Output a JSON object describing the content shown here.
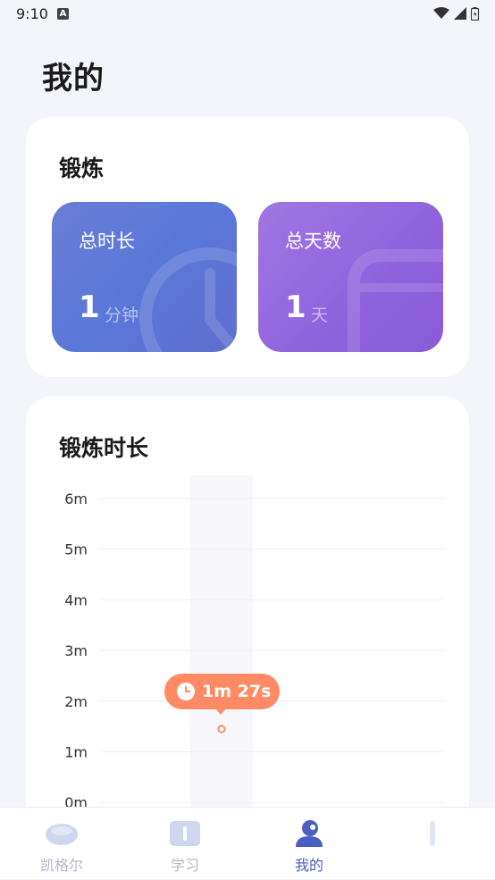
{
  "status_bar": {
    "time": "9:10",
    "badge": "A"
  },
  "page_title": "我的",
  "exercise_card": {
    "title": "锻炼",
    "stats": [
      {
        "label": "总时长",
        "value": "1",
        "unit": "分钟",
        "icon": "clock-icon"
      },
      {
        "label": "总天数",
        "value": "1",
        "unit": "天",
        "icon": "calendar-icon"
      }
    ]
  },
  "chart_card": {
    "title": "锻炼时长"
  },
  "chart_data": {
    "type": "scatter",
    "title": "锻炼时长",
    "y_ticks": [
      "6m",
      "5m",
      "4m",
      "3m",
      "2m",
      "1m",
      "0m"
    ],
    "ylim": [
      0,
      6
    ],
    "y_unit": "minutes",
    "grid": true,
    "points": [
      {
        "y": 1.45,
        "label": "1m 27s"
      }
    ],
    "highlight_color": "#ff8a64"
  },
  "tooltip": {
    "text": "1m 27s"
  },
  "tab_bar": {
    "tabs": [
      {
        "label": "凯格尔",
        "icon": "kegel-icon",
        "active": false
      },
      {
        "label": "学习",
        "icon": "book-icon",
        "active": false
      },
      {
        "label": "我的",
        "icon": "profile-icon",
        "active": true
      },
      {
        "label": "",
        "icon": "tab-icon",
        "active": false
      }
    ]
  },
  "colors": {
    "accent": "#4c5fc0",
    "tooltip": "#ff8a64",
    "inactive": "#b4b8cc"
  }
}
